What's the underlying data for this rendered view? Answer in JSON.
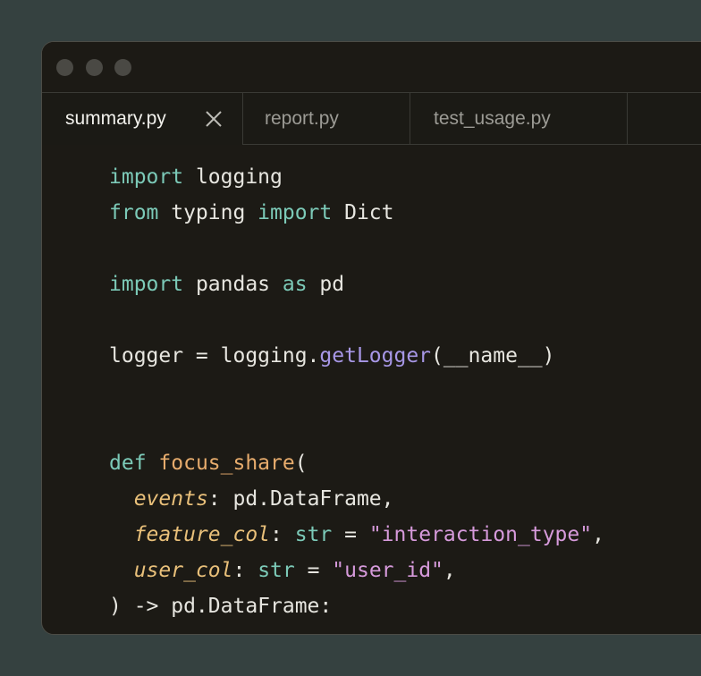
{
  "tabs": [
    {
      "label": "summary.py",
      "active": true
    },
    {
      "label": "report.py",
      "active": false
    },
    {
      "label": "test_usage.py",
      "active": false
    }
  ],
  "tab_close_icon": "close-icon",
  "colors": {
    "background": "#354140",
    "editor_bg": "#1c1a15",
    "keyword": "#7ccab8",
    "function_call": "#a797e6",
    "function_def": "#e7ac6d",
    "parameter": "#e9c07a",
    "string": "#d69adb",
    "text": "#e7e6e0"
  },
  "code_lines": [
    [
      {
        "t": "kw",
        "v": "import"
      },
      {
        "t": "plain",
        "v": " logging"
      }
    ],
    [
      {
        "t": "kw",
        "v": "from"
      },
      {
        "t": "plain",
        "v": " typing "
      },
      {
        "t": "kw",
        "v": "import"
      },
      {
        "t": "plain",
        "v": " Dict"
      }
    ],
    [],
    [
      {
        "t": "kw",
        "v": "import"
      },
      {
        "t": "plain",
        "v": " pandas "
      },
      {
        "t": "kw",
        "v": "as"
      },
      {
        "t": "plain",
        "v": " pd"
      }
    ],
    [],
    [
      {
        "t": "plain",
        "v": "logger = logging."
      },
      {
        "t": "fn",
        "v": "getLogger"
      },
      {
        "t": "plain",
        "v": "(__name__)"
      }
    ],
    [],
    [],
    [
      {
        "t": "kw",
        "v": "def"
      },
      {
        "t": "plain",
        "v": " "
      },
      {
        "t": "def",
        "v": "focus_share"
      },
      {
        "t": "plain",
        "v": "("
      }
    ],
    [
      {
        "t": "plain",
        "v": "  "
      },
      {
        "t": "param",
        "v": "events"
      },
      {
        "t": "plain",
        "v": ": pd.DataFrame,"
      }
    ],
    [
      {
        "t": "plain",
        "v": "  "
      },
      {
        "t": "param",
        "v": "feature_col"
      },
      {
        "t": "plain",
        "v": ": "
      },
      {
        "t": "kw",
        "v": "str"
      },
      {
        "t": "plain",
        "v": " = "
      },
      {
        "t": "str",
        "v": "\"interaction_type\""
      },
      {
        "t": "plain",
        "v": ","
      }
    ],
    [
      {
        "t": "plain",
        "v": "  "
      },
      {
        "t": "param",
        "v": "user_col"
      },
      {
        "t": "plain",
        "v": ": "
      },
      {
        "t": "kw",
        "v": "str"
      },
      {
        "t": "plain",
        "v": " = "
      },
      {
        "t": "str",
        "v": "\"user_id\""
      },
      {
        "t": "plain",
        "v": ","
      }
    ],
    [
      {
        "t": "plain",
        "v": ") -> pd.DataFrame:"
      }
    ]
  ]
}
